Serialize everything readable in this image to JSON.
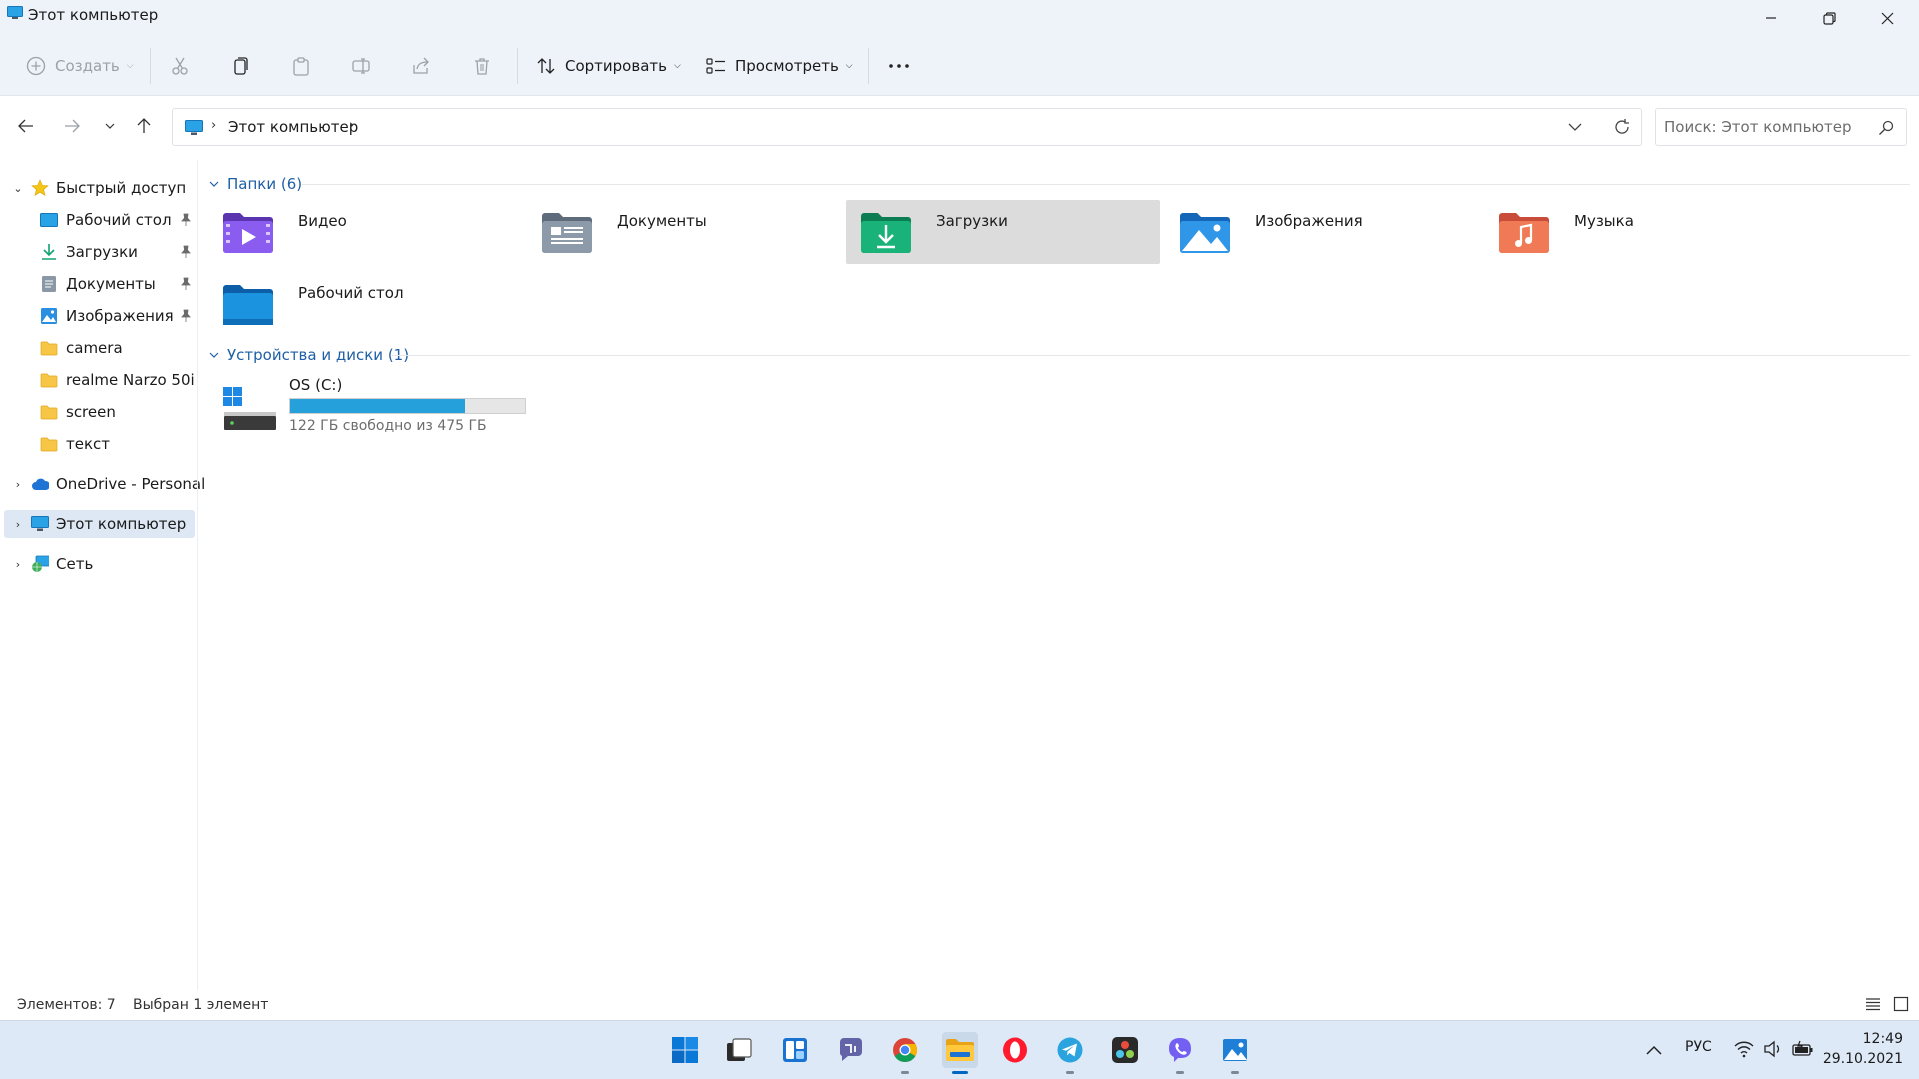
{
  "window": {
    "title": "Этот компьютер"
  },
  "toolbar": {
    "create_label": "Создать",
    "sort_label": "Сортировать",
    "view_label": "Просмотреть"
  },
  "address": {
    "crumb": "Этот компьютер"
  },
  "search": {
    "placeholder": "Поиск: Этот компьютер"
  },
  "sidebar": {
    "quick_access": "Быстрый доступ",
    "items": [
      {
        "label": "Рабочий стол",
        "pinned": true
      },
      {
        "label": "Загрузки",
        "pinned": true
      },
      {
        "label": "Документы",
        "pinned": true
      },
      {
        "label": "Изображения",
        "pinned": true
      },
      {
        "label": "camera",
        "pinned": false
      },
      {
        "label": "realme Narzo 50i",
        "pinned": false
      },
      {
        "label": "screen",
        "pinned": false
      },
      {
        "label": "текст",
        "pinned": false
      }
    ],
    "onedrive": "OneDrive - Personal",
    "this_pc": "Этот компьютер",
    "network": "Сеть"
  },
  "content": {
    "folders_header": "Папки (6)",
    "folders": [
      {
        "name": "Видео",
        "icon": "video-folder-icon",
        "color": "#7c4dd8"
      },
      {
        "name": "Документы",
        "icon": "documents-folder-icon",
        "color": "#7d8a99"
      },
      {
        "name": "Загрузки",
        "icon": "downloads-folder-icon",
        "color": "#12a36f"
      },
      {
        "name": "Изображения",
        "icon": "pictures-folder-icon",
        "color": "#2a8fe0"
      },
      {
        "name": "Музыка",
        "icon": "music-folder-icon",
        "color": "#f06a4a"
      },
      {
        "name": "Рабочий стол",
        "icon": "desktop-folder-icon",
        "color": "#1a8ad8"
      }
    ],
    "devices_header": "Устройства и диски (1)",
    "drive": {
      "name": "OS (C:)",
      "free_text": "122 ГБ свободно из 475 ГБ",
      "used_fraction": 0.743
    }
  },
  "status": {
    "items_count": "Элементов: 7",
    "selected": "Выбран 1 элемент"
  },
  "taskbar": {
    "language": "РУС",
    "time": "12:49",
    "date": "29.10.2021"
  },
  "colors": {
    "accent": "#0067c0",
    "drive_bar": "#26a0da",
    "group_header": "#1f5fa5",
    "selection": "#dcdcdc"
  }
}
